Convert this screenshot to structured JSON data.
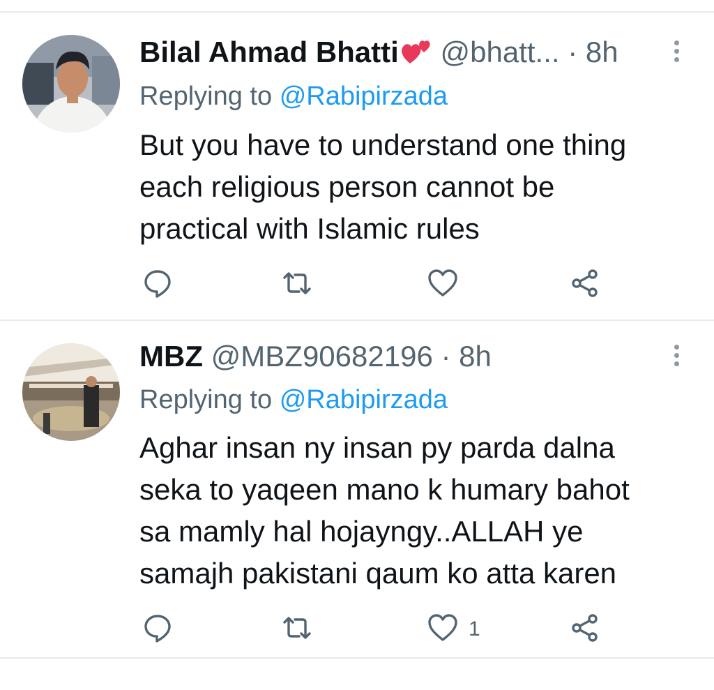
{
  "tweets": [
    {
      "name": "Bilal Ahmad Bhatti",
      "handle": "@bhatt...",
      "separator": "·",
      "time": "8h",
      "replying_prefix": "Replying to",
      "replying_to": "@Rabipirzada",
      "text_lines": [
        "But you have to understand one thing",
        "each religious person cannot be",
        "practical with Islamic rules"
      ],
      "like_count": ""
    },
    {
      "name": "MBZ",
      "handle": "@MBZ90682196",
      "separator": "·",
      "time": "8h",
      "replying_prefix": "Replying to",
      "replying_to": "@Rabipirzada",
      "text_lines": [
        "Aghar insan ny insan py parda dalna",
        "seka to yaqeen mano k humary bahot",
        "sa mamly hal hojayngy..ALLAH ye",
        "samajh pakistani qaum ko atta karen"
      ],
      "like_count": "1"
    }
  ],
  "icons": {
    "reply": "reply-icon",
    "retweet": "retweet-icon",
    "like": "heart-icon",
    "share": "share-icon",
    "more": "more-options-icon",
    "emoji": "two-hearts-emoji"
  },
  "colors": {
    "accent": "#1d9bf0",
    "secondary_text": "#536471",
    "divider": "#e7eaed",
    "emoji_heart": "#e8395a"
  }
}
